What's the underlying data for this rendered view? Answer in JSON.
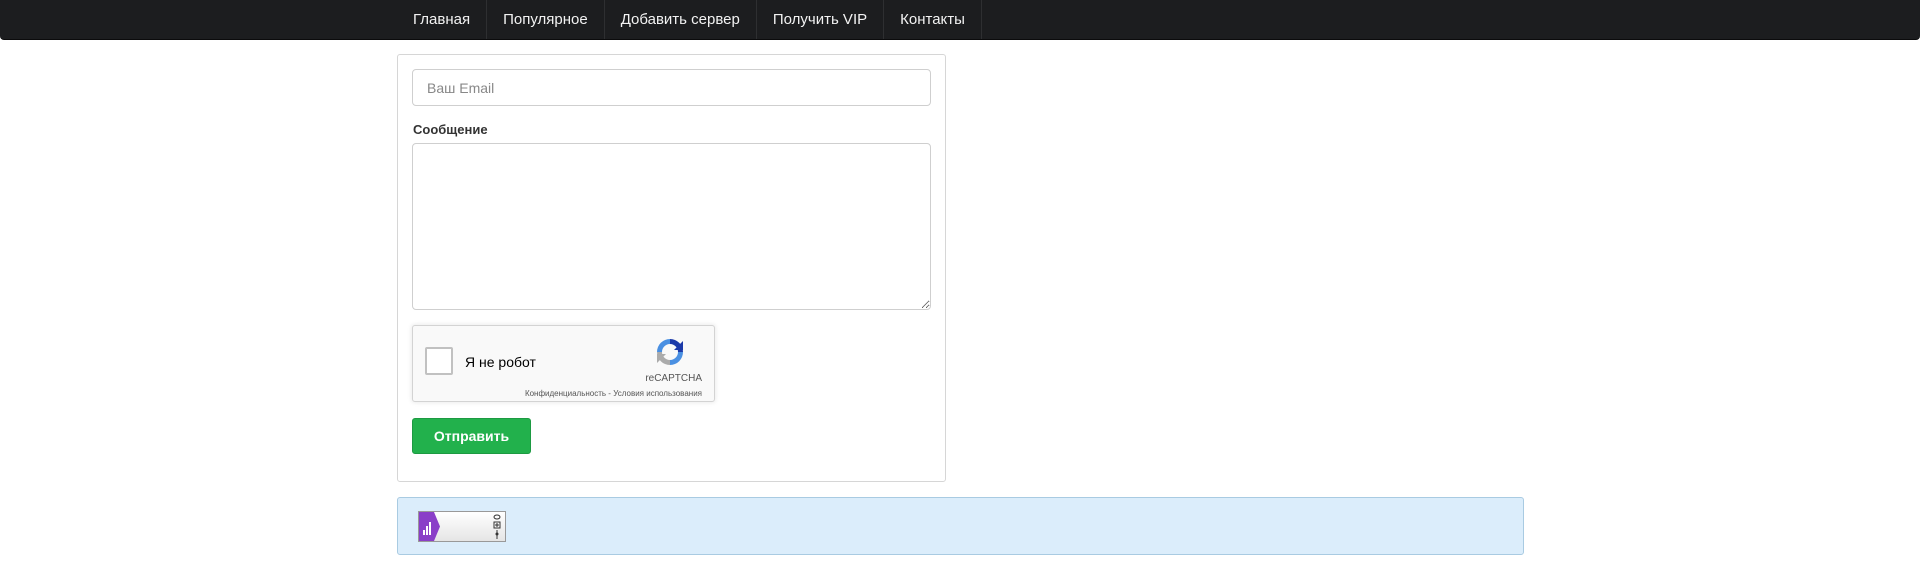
{
  "nav": {
    "items": [
      {
        "label": "Главная"
      },
      {
        "label": "Популярное"
      },
      {
        "label": "Добавить сервер"
      },
      {
        "label": "Получить VIP"
      },
      {
        "label": "Контакты"
      }
    ]
  },
  "form": {
    "email_placeholder": "Ваш Email",
    "email_value": "",
    "message_label": "Сообщение",
    "message_value": "",
    "submit_label": "Отправить"
  },
  "recaptcha": {
    "label": "Я не робот",
    "brand": "reCAPTCHA",
    "links": "Конфиденциальность - Условия использования",
    "checked": false
  },
  "counter": {
    "icon": "bar-chart-icon"
  },
  "colors": {
    "navbar_bg": "#1c1d1f",
    "submit_bg": "#22b14c",
    "info_bg": "#dbedfb",
    "counter_accent": "#8a3fc8"
  }
}
